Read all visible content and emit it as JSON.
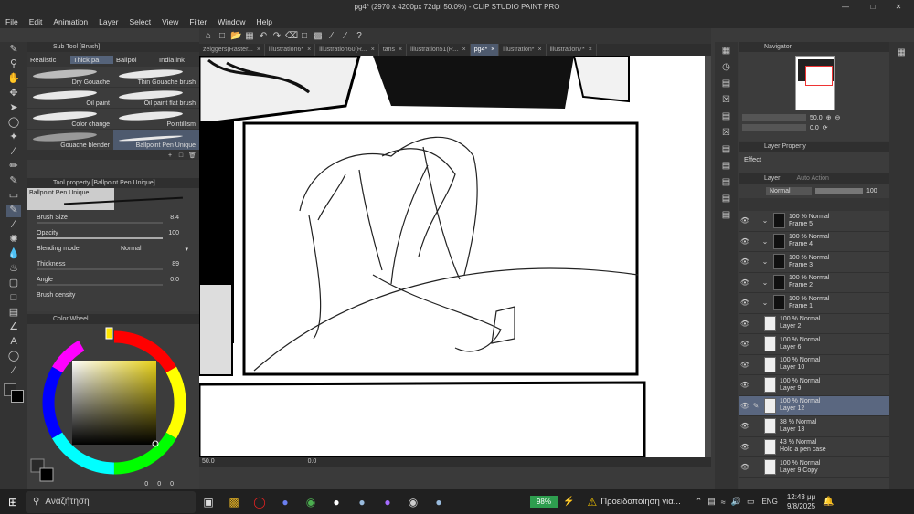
{
  "title": "pg4* (2970 x 4200px 72dpi 50.0%) - CLIP STUDIO PAINT PRO",
  "menu": [
    "File",
    "Edit",
    "Animation",
    "Layer",
    "Select",
    "View",
    "Filter",
    "Window",
    "Help"
  ],
  "tabs": [
    {
      "label": "zelggers(Raster...",
      "active": false
    },
    {
      "label": "illustration6*",
      "active": false
    },
    {
      "label": "illustration60(R...",
      "active": false
    },
    {
      "label": "tans",
      "active": false
    },
    {
      "label": "illustration51(R...",
      "active": false
    },
    {
      "label": "pg4*",
      "active": true
    },
    {
      "label": "illustration*",
      "active": false
    },
    {
      "label": "illustration7*",
      "active": false
    }
  ],
  "subtool": {
    "header": "Sub Tool [Brush]",
    "tabs": [
      {
        "label": "Realistic",
        "active": false
      },
      {
        "label": "Thick pa",
        "active": true
      },
      {
        "label": "Ballpoi",
        "active": false
      },
      {
        "label": "India ink",
        "active": false
      }
    ],
    "brushes": [
      {
        "label": "Dry Gouache",
        "selected": false
      },
      {
        "label": "Thin Gouache brush",
        "selected": false
      },
      {
        "label": "Oil paint",
        "selected": false
      },
      {
        "label": "Oil paint flat brush",
        "selected": false
      },
      {
        "label": "Color change",
        "selected": false
      },
      {
        "label": "Pointillism",
        "selected": false
      },
      {
        "label": "Gouache blender",
        "selected": false
      },
      {
        "label": "Ballpoint Pen Unique",
        "selected": true
      }
    ]
  },
  "toolprop": {
    "header": "Tool property [Ballpoint Pen Unique]",
    "name": "Ballpoint Pen Unique",
    "brush_size_label": "Brush Size",
    "brush_size": "8.4",
    "opacity_label": "Opacity",
    "opacity": "100",
    "blending_label": "Blending mode",
    "blending": "Normal",
    "thickness_label": "Thickness",
    "thickness": "89",
    "angle_label": "Angle",
    "angle": "0.0",
    "density_label": "Brush density"
  },
  "colorwheel": {
    "header": "Color Wheel",
    "r": "0",
    "g": "0",
    "b": "0",
    "main_color": "#000000",
    "sub_color": "#2a2a2a"
  },
  "canvas": {
    "zoom": "50.0",
    "angle": "0.0"
  },
  "navigator": {
    "header": "Navigator",
    "zoom": "50.0",
    "angle": "0.0"
  },
  "layerprop": {
    "header": "Layer Property",
    "effect": "Effect"
  },
  "layers_panel": {
    "header": "Layer",
    "autoaction": "Auto Action",
    "blend": "Normal",
    "opacity": "100"
  },
  "layers": [
    {
      "line1": "100 % Normal",
      "line2": "Frame 5",
      "folder": true,
      "selected": false
    },
    {
      "line1": "100 % Normal",
      "line2": "Frame 4",
      "folder": true,
      "selected": false
    },
    {
      "line1": "100 % Normal",
      "line2": "Frame 3",
      "folder": true,
      "selected": false
    },
    {
      "line1": "100 % Normal",
      "line2": "Frame 2",
      "folder": true,
      "selected": false
    },
    {
      "line1": "100 % Normal",
      "line2": "Frame 1",
      "folder": true,
      "selected": false
    },
    {
      "line1": "100 % Normal",
      "line2": "Layer 2",
      "folder": false,
      "selected": false
    },
    {
      "line1": "100 % Normal",
      "line2": "Layer 6",
      "folder": false,
      "selected": false
    },
    {
      "line1": "100 % Normal",
      "line2": "Layer 10",
      "folder": false,
      "selected": false
    },
    {
      "line1": "100 % Normal",
      "line2": "Layer 9",
      "folder": false,
      "selected": false
    },
    {
      "line1": "100 % Normal",
      "line2": "Layer 12",
      "folder": false,
      "selected": true
    },
    {
      "line1": "38 % Normal",
      "line2": "Layer 13",
      "folder": false,
      "selected": false
    },
    {
      "line1": "43 % Normal",
      "line2": "Hold a pen case",
      "folder": false,
      "selected": false
    },
    {
      "line1": "100 % Normal",
      "line2": "Layer 9 Copy",
      "folder": false,
      "selected": false
    }
  ],
  "taskbar": {
    "search_placeholder": "Αναζήτηση",
    "battery": "98%",
    "warning": "Προειδοποίηση για...",
    "lang": "ENG",
    "time": "12:43 μμ",
    "date": "9/8/2025"
  },
  "colors": {
    "accent": "#4e5a6e",
    "battery": "#2e9e4f"
  }
}
